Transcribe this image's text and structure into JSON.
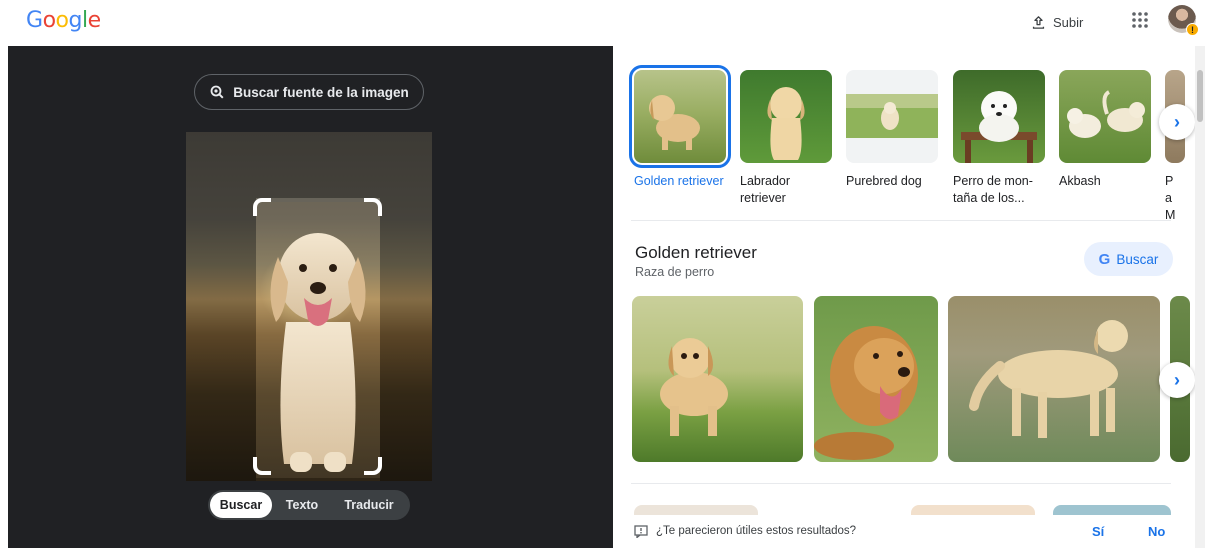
{
  "header": {
    "logo_letters": [
      "G",
      "o",
      "o",
      "g",
      "l",
      "e"
    ],
    "upload_label": "Subir"
  },
  "left": {
    "source_button": "Buscar fuente de la imagen",
    "modes": [
      {
        "label": "Buscar",
        "active": true
      },
      {
        "label": "Texto",
        "active": false
      },
      {
        "label": "Traducir",
        "active": false
      }
    ]
  },
  "categories": [
    {
      "label": "Golden retriever",
      "selected": true
    },
    {
      "label": "Labrador retriever",
      "selected": false
    },
    {
      "label": "Purebred dog",
      "selected": false
    },
    {
      "label": "Perro de mon-taña de los...",
      "selected": false
    },
    {
      "label": "Akbash",
      "selected": false
    },
    {
      "label": "Pa M",
      "selected": false
    }
  ],
  "knowledge": {
    "title": "Golden retriever",
    "subtitle": "Raza de perro",
    "search_button": "Buscar"
  },
  "feedback": {
    "question": "¿Te parecieron útiles estos resultados?",
    "yes": "Sí",
    "no": "No"
  },
  "colors": {
    "accent": "#1a73e8",
    "dark_panel": "#202124"
  }
}
